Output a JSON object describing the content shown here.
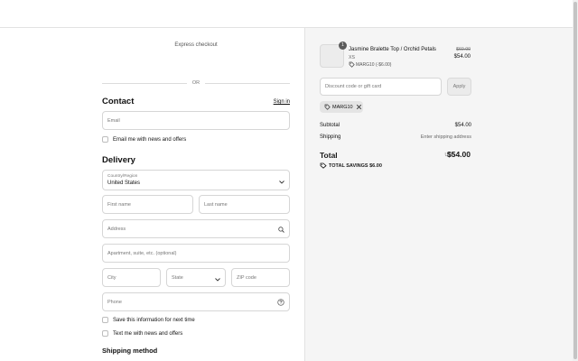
{
  "left": {
    "express_checkout": "Express checkout",
    "or": "OR",
    "contact": {
      "heading": "Contact",
      "sign_in": "Sign in",
      "email_placeholder": "Email",
      "email_offers": "Email me with news and offers"
    },
    "delivery": {
      "heading": "Delivery",
      "country_label": "Country/Region",
      "country_value": "United States",
      "first_name": "First name",
      "last_name": "Last name",
      "address": "Address",
      "apartment": "Apartment, suite, etc. (optional)",
      "city": "City",
      "state": "State",
      "zip": "ZIP code",
      "phone": "Phone",
      "save_info": "Save this information for next time",
      "text_offers": "Text me with news and offers"
    },
    "shipping_method": "Shipping method"
  },
  "summary": {
    "product": {
      "quantity": "1",
      "name": "Jasmine Bralette Top / Orchid Petals",
      "variant": "XS",
      "discount": "MARG10 (-$6.00)",
      "old_price": "$60.00",
      "price": "$54.00"
    },
    "discount_placeholder": "Discount code or gift card",
    "apply": "Apply",
    "applied_code": "MARG10",
    "subtotal_label": "Subtotal",
    "subtotal_value": "$54.00",
    "shipping_label": "Shipping",
    "shipping_value": "Enter shipping address",
    "total_label": "Total",
    "currency": "USD",
    "total_value": "$54.00",
    "savings": "TOTAL SAVINGS  $6.00"
  },
  "icons": {
    "tag": "tag-icon",
    "close": "close-icon",
    "search": "search-icon",
    "help": "help-circle-icon",
    "chevron": "chevron-down-icon"
  }
}
